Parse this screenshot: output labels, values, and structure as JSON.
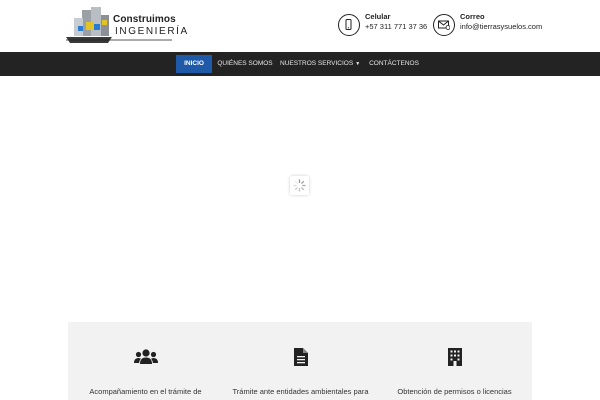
{
  "header": {
    "logo": {
      "line1": "Construimos",
      "line2": "INGENIERÍA"
    },
    "phone": {
      "label": "Celular",
      "value": "+57 311 771 37 36",
      "icon": "mobile-phone-icon"
    },
    "email": {
      "label": "Correo",
      "value": "info@tierrasysuelos.com",
      "icon": "envelope-icon"
    }
  },
  "nav": {
    "items": [
      {
        "label": "INICIO",
        "active": true
      },
      {
        "label": "QUIÉNES SOMOS"
      },
      {
        "label": "NUESTROS SERVICIOS",
        "dropdown": true
      },
      {
        "label": "CONTÁCTENOS"
      }
    ],
    "active_color": "#1f5aa8",
    "bar_color": "#232323"
  },
  "hero": {
    "loader_icon": "loading-spinner-icon"
  },
  "services": [
    {
      "icon": "users-icon",
      "text": "Acompañamiento en el trámite de permisos"
    },
    {
      "icon": "document-icon",
      "text": "Trámite ante entidades ambientales para permisos"
    },
    {
      "icon": "building-icon",
      "text": "Obtención de permisos o licencias urbanísticas"
    }
  ]
}
